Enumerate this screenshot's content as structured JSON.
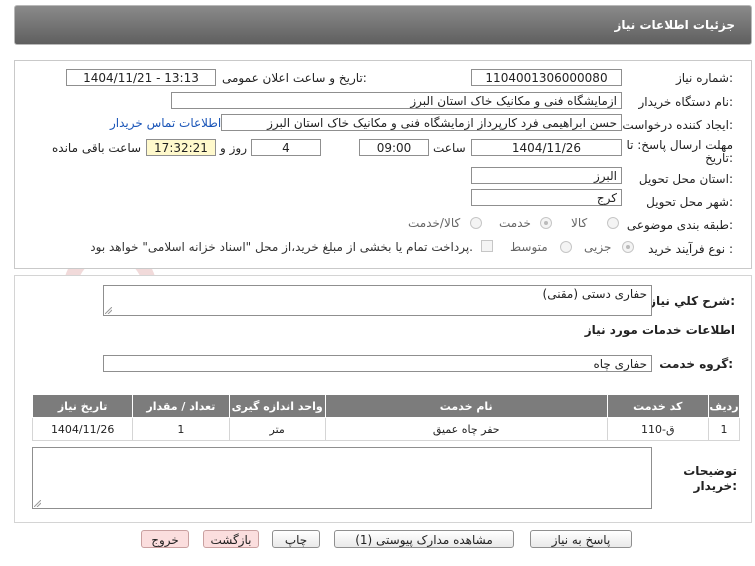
{
  "header": {
    "title": "جزئیات اطلاعات نیاز"
  },
  "form": {
    "need_number_label": "شماره نیاز:",
    "need_number": "1104001306000080",
    "announce_label": "تاریخ و ساعت اعلان عمومی:",
    "announce_value": "1404/11/21 - 13:13",
    "buyer_org_label": "نام دستگاه خریدار:",
    "buyer_org": "ازمایشگاه فنی و مکانیک خاک استان البرز",
    "requester_label": "ایجاد کننده درخواست:",
    "requester": "حسن ابراهیمی فرد کارپرداز ازمایشگاه فنی و مکانیک خاک استان البرز",
    "contact_link": "اطلاعات تماس خریدار",
    "deadline_label_1": "مهلت ارسال پاسخ: تا",
    "deadline_label_2": "تاریخ:",
    "deadline_date": "1404/11/26",
    "time_label": "ساعت",
    "deadline_time": "09:00",
    "days_value": "4",
    "days_label": "روز و",
    "remaining_time": "17:32:21",
    "remaining_label": "ساعت باقی مانده",
    "province_label": "استان محل تحویل:",
    "province": "البرز",
    "city_label": "شهر محل تحویل:",
    "city": "کرج",
    "category_label": "طبقه بندی موضوعی:",
    "category_options": [
      "کالا",
      "خدمت",
      "کالا/خدمت"
    ],
    "category_selected": "خدمت",
    "process_label": "نوع فرآیند خرید :",
    "process_options": [
      "جزیی",
      "متوسط"
    ],
    "process_selected": "جزیی",
    "payment_note": "پرداخت تمام یا بخشی از مبلغ خرید،از محل \"اسناد خزانه اسلامی\" خواهد بود."
  },
  "description": {
    "label": "شرح کلي نیاز:",
    "value": "حفاری دستی (مقنی)"
  },
  "services": {
    "section_title": "اطلاعات خدمات مورد نیاز",
    "group_label": "گروه خدمت:",
    "group_value": "حفاری چاه",
    "columns": [
      "ردیف",
      "کد خدمت",
      "نام خدمت",
      "واحد اندازه گیری",
      "تعداد / مقدار",
      "تاریخ نیاز"
    ],
    "rows": [
      {
        "row": "1",
        "code": "ق-110",
        "name": "حفر چاه عمیق",
        "unit": "متر",
        "qty": "1",
        "date": "1404/11/26"
      }
    ]
  },
  "buyer_notes": {
    "label_1": "توضیحات",
    "label_2": "خریدار:",
    "value": ""
  },
  "buttons": {
    "reply": "پاسخ به نیاز",
    "view_docs": "مشاهده مدارک پیوستی (1)",
    "print": "چاپ",
    "back": "بازگشت",
    "exit": "خروج"
  },
  "watermark": "AriaTender.net",
  "colors": {
    "header_bg": "#6e6e6e",
    "link": "#1a55b8",
    "highlight": "#fff9cc",
    "table_header": "#7c7c7c",
    "watermark": "#f0d6d6"
  }
}
